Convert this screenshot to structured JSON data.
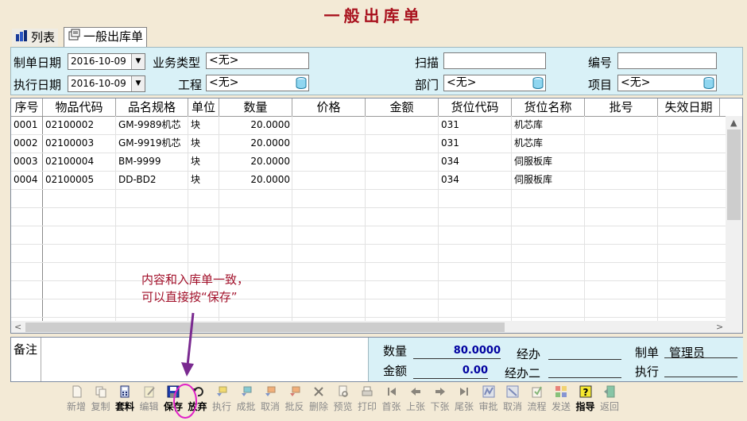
{
  "title": "一般出库单",
  "tabs": [
    {
      "label": "列表",
      "icon": "chart-icon"
    },
    {
      "label": "一般出库单",
      "icon": "document-icon"
    }
  ],
  "form": {
    "make_date_label": "制单日期",
    "make_date_value": "2016-10-09",
    "exec_date_label": "执行日期",
    "exec_date_value": "2016-10-09",
    "business_type_label": "业务类型",
    "business_type_value": "<无>",
    "project_label": "工程",
    "project_value": "<无>",
    "scan_label": "扫描",
    "scan_value": "",
    "dept_label": "部门",
    "dept_value": "<无>",
    "number_label": "编号",
    "number_value": "",
    "item_label": "项目",
    "item_value": "<无>"
  },
  "grid": {
    "headers": [
      "序号",
      "物品代码",
      "品名规格",
      "单位",
      "数量",
      "价格",
      "金额",
      "货位代码",
      "货位名称",
      "批号",
      "失效日期"
    ],
    "rows": [
      [
        "0001",
        "02100002",
        "GM-9989机芯",
        "块",
        "20.0000",
        "",
        "",
        "031",
        "机芯库",
        "",
        ""
      ],
      [
        "0002",
        "02100003",
        "GM-9919机芯",
        "块",
        "20.0000",
        "",
        "",
        "031",
        "机芯库",
        "",
        ""
      ],
      [
        "0003",
        "02100004",
        "BM-9999",
        "块",
        "20.0000",
        "",
        "",
        "034",
        "伺服板库",
        "",
        ""
      ],
      [
        "0004",
        "02100005",
        "DD-BD2",
        "块",
        "20.0000",
        "",
        "",
        "034",
        "伺服板库",
        "",
        ""
      ]
    ]
  },
  "footer": {
    "remark_label": "备注",
    "quantity_label": "数量",
    "quantity_value": "80.0000",
    "amount_label": "金额",
    "amount_value": "0.00",
    "handler_label": "经办",
    "handler2_label": "经办二",
    "maker_label": "制单",
    "maker_value": "管理员",
    "executor_label": "执行"
  },
  "annotation": {
    "line1": "内容和入库单一致，",
    "line2": "可以直接按“保存”",
    "color": "#a2102a"
  },
  "toolbar": [
    {
      "label": "新增",
      "icon": "new-doc-icon",
      "enabled": false
    },
    {
      "label": "复制",
      "icon": "copy-icon",
      "enabled": false
    },
    {
      "label": "套料",
      "icon": "calculator-icon",
      "enabled": true
    },
    {
      "label": "编辑",
      "icon": "edit-icon",
      "enabled": false
    },
    {
      "label": "保存",
      "icon": "save-icon",
      "enabled": true
    },
    {
      "label": "放弃",
      "icon": "undo-icon",
      "enabled": true
    },
    {
      "label": "执行",
      "icon": "execute-icon",
      "enabled": false
    },
    {
      "label": "成批",
      "icon": "batch-icon",
      "enabled": false
    },
    {
      "label": "取消",
      "icon": "cancel-icon",
      "enabled": false
    },
    {
      "label": "批反",
      "icon": "batch-reverse-icon",
      "enabled": false
    },
    {
      "label": "删除",
      "icon": "delete-icon",
      "enabled": false
    },
    {
      "label": "预览",
      "icon": "preview-icon",
      "enabled": false
    },
    {
      "label": "打印",
      "icon": "print-icon",
      "enabled": false
    },
    {
      "label": "首张",
      "icon": "first-icon",
      "enabled": false
    },
    {
      "label": "上张",
      "icon": "prev-icon",
      "enabled": false
    },
    {
      "label": "下张",
      "icon": "next-icon",
      "enabled": false
    },
    {
      "label": "尾张",
      "icon": "last-icon",
      "enabled": false
    },
    {
      "label": "审批",
      "icon": "approve-icon",
      "enabled": false
    },
    {
      "label": "取消",
      "icon": "unapprove-icon",
      "enabled": false
    },
    {
      "label": "流程",
      "icon": "workflow-icon",
      "enabled": false
    },
    {
      "label": "发送",
      "icon": "send-icon",
      "enabled": false
    },
    {
      "label": "指导",
      "icon": "help-icon",
      "enabled": true
    },
    {
      "label": "返回",
      "icon": "exit-icon",
      "enabled": false
    }
  ],
  "colors": {
    "title": "#a8101c",
    "form_bg": "#d9f1f7",
    "window_bg": "#f3ead6",
    "footer_values": "#0000a0",
    "highlight_circle": "#e020c8",
    "arrow": "#7a2a90"
  }
}
